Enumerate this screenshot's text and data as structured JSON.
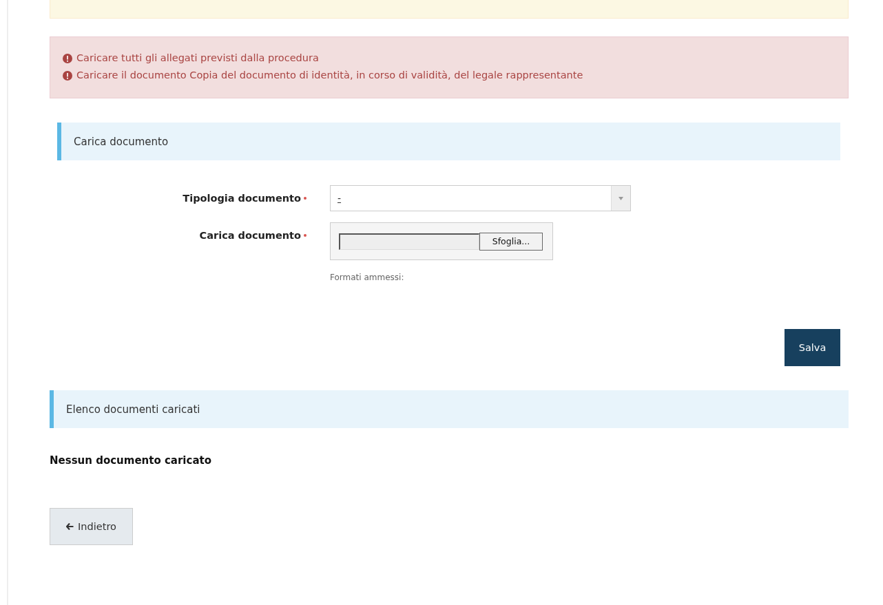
{
  "errors": [
    "Caricare tutti gli allegati previsti dalla procedura",
    "Caricare il documento Copia del documento di identità, in corso di validità, del legale rappresentante"
  ],
  "upload_section": {
    "title": "Carica documento",
    "fields": [
      {
        "kind": "select",
        "label": "Tipologia documento",
        "required": true,
        "value": "-"
      },
      {
        "kind": "file",
        "label": "Carica documento",
        "required": true,
        "button": "Sfoglia...",
        "help": "Formati ammessi:"
      }
    ],
    "save_button": "Salva"
  },
  "list_section": {
    "title": "Elenco documenti caricati",
    "empty_message": "Nessun documento caricato"
  },
  "back_button": "Indietro"
}
